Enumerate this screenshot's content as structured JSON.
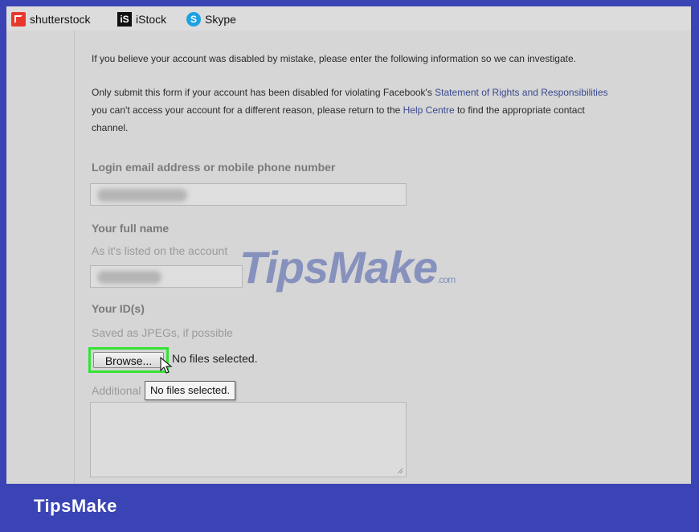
{
  "bookmarks": [
    {
      "label": "shutterstock",
      "icon": "shutterstock-icon"
    },
    {
      "label": "iStock",
      "icon": "istock-icon"
    },
    {
      "label": "Skype",
      "icon": "skype-icon"
    }
  ],
  "intro": {
    "line1": "If you believe your account was disabled by mistake, please enter the following information so we can investigate.",
    "p2_part1": "Only submit this form if your account has been disabled for violating Facebook's ",
    "p2_link1": "Statement of Rights and Responsibilities",
    "p2_part2": "you can't access your account for a different reason, please return to the ",
    "p2_link2": "Help Centre",
    "p2_part3": " to find the appropriate contact",
    "p2_part4": "channel."
  },
  "form": {
    "login_label": "Login email address or mobile phone number",
    "name_label": "Your full name",
    "name_hint": "As it's listed on the account",
    "id_label": "Your ID(s)",
    "id_hint": "Saved as JPEGs, if possible",
    "browse_label": "Browse...",
    "no_files": "No files selected.",
    "additional_label": "Additional",
    "tooltip": "No files selected."
  },
  "watermark": {
    "main": "TipsMake",
    "suffix": ".com"
  },
  "brand": "TipsMake",
  "colors": {
    "frame": "#3a44b4",
    "highlight": "#34e334",
    "link": "#3b4a8f"
  }
}
